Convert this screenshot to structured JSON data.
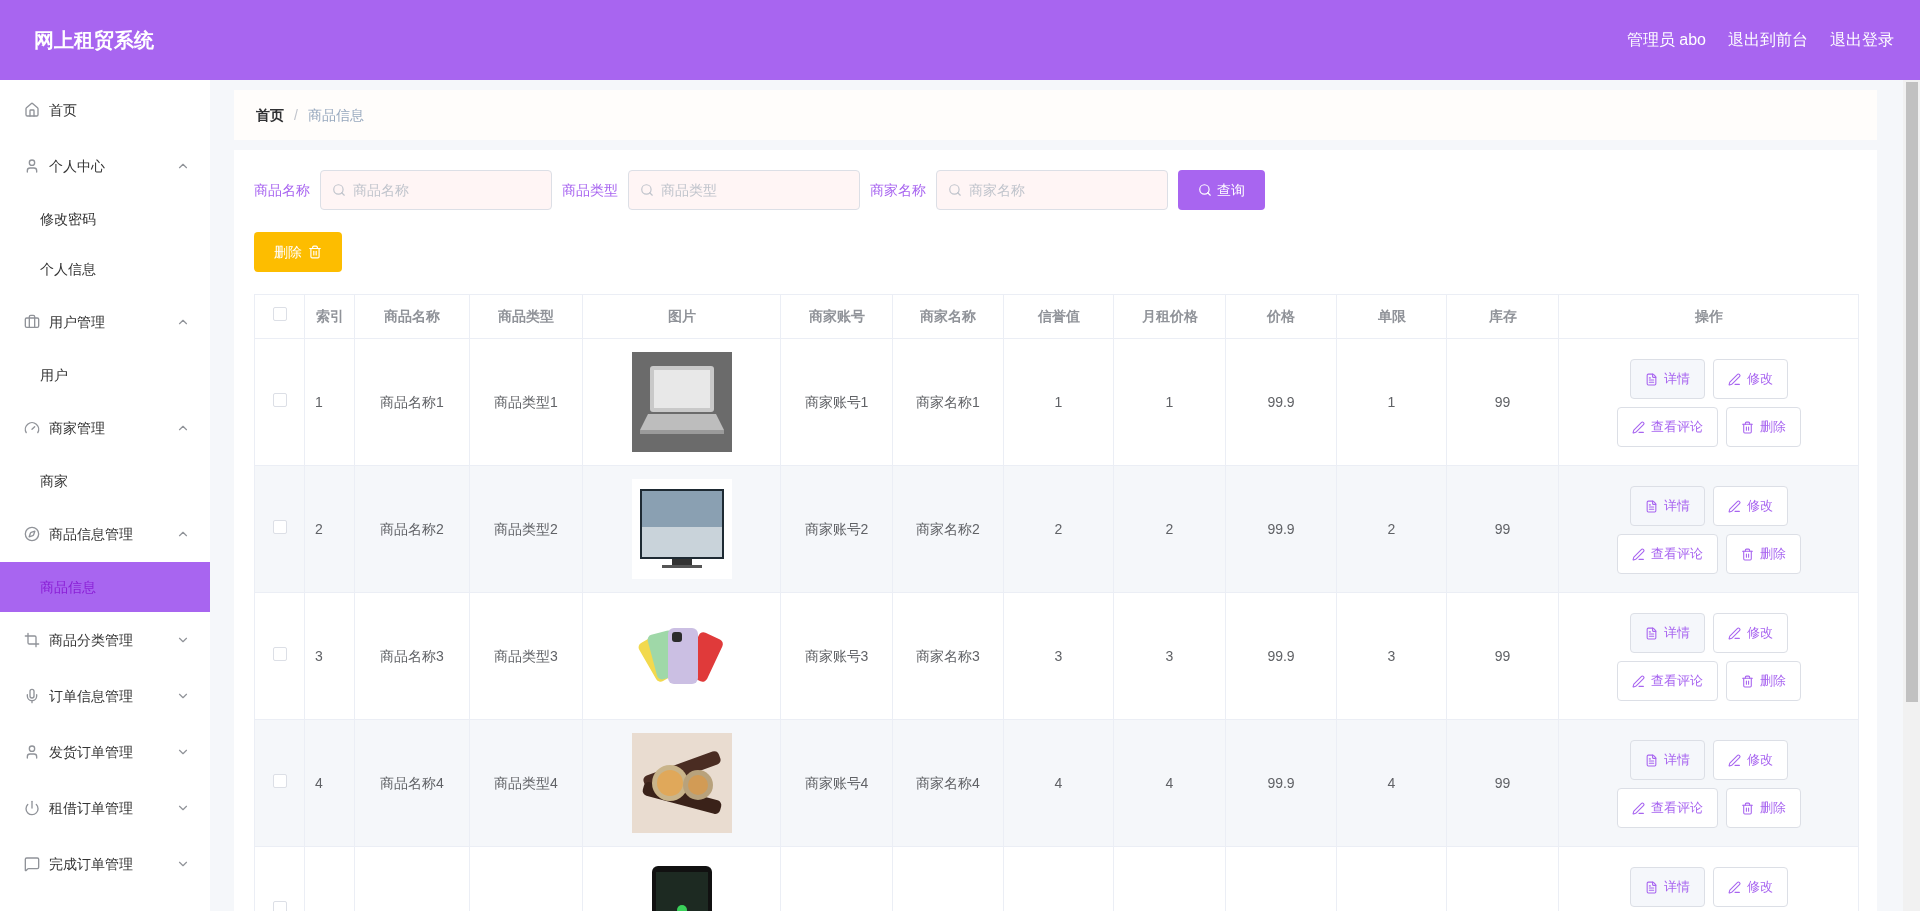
{
  "header": {
    "title": "网上租贸系统",
    "links": [
      "管理员 abo",
      "退出到前台",
      "退出登录"
    ]
  },
  "sidebar": {
    "items": [
      {
        "label": "首页",
        "kind": "link"
      },
      {
        "label": "个人中心",
        "kind": "group",
        "expanded": true,
        "children": [
          {
            "label": "修改密码",
            "selected": false
          },
          {
            "label": "个人信息",
            "selected": false
          }
        ]
      },
      {
        "label": "用户管理",
        "kind": "group",
        "expanded": true,
        "children": [
          {
            "label": "用户",
            "selected": false
          }
        ]
      },
      {
        "label": "商家管理",
        "kind": "group",
        "expanded": true,
        "children": [
          {
            "label": "商家",
            "selected": false
          }
        ]
      },
      {
        "label": "商品信息管理",
        "kind": "group",
        "expanded": true,
        "children": [
          {
            "label": "商品信息",
            "selected": true
          }
        ]
      },
      {
        "label": "商品分类管理",
        "kind": "group",
        "expanded": false
      },
      {
        "label": "订单信息管理",
        "kind": "group",
        "expanded": false
      },
      {
        "label": "发货订单管理",
        "kind": "group",
        "expanded": false
      },
      {
        "label": "租借订单管理",
        "kind": "group",
        "expanded": false
      },
      {
        "label": "完成订单管理",
        "kind": "group",
        "expanded": false
      }
    ]
  },
  "breadcrumb": {
    "items": [
      "首页",
      "商品信息"
    ],
    "separator": "/"
  },
  "search": {
    "fields": [
      {
        "label": "商品名称",
        "placeholder": "商品名称"
      },
      {
        "label": "商品类型",
        "placeholder": "商品类型"
      },
      {
        "label": "商家名称",
        "placeholder": "商家名称"
      }
    ],
    "button": "查询"
  },
  "delete_button": "删除",
  "table": {
    "all_checked": false,
    "columns": [
      "索引",
      "商品名称",
      "商品类型",
      "图片",
      "商家账号",
      "商家名称",
      "信誉值",
      "月租价格",
      "价格",
      "单限",
      "库存",
      "操作"
    ],
    "rows": [
      {
        "checked": false,
        "cells": [
          "1",
          "商品名称1",
          "商品类型1",
          "",
          "商家账号1",
          "商家名称1",
          "1",
          "1",
          "99.9",
          "1",
          "99"
        ],
        "image": {
          "kind": "picture"
        },
        "actions": [
          "详情",
          "修改",
          "查看评论",
          "删除"
        ]
      },
      {
        "checked": false,
        "cells": [
          "2",
          "商品名称2",
          "商品类型2",
          "",
          "商家账号2",
          "商家名称2",
          "2",
          "2",
          "99.9",
          "2",
          "99"
        ],
        "image": {
          "kind": "picture"
        },
        "actions": [
          "详情",
          "修改",
          "查看评论",
          "删除"
        ]
      },
      {
        "checked": false,
        "cells": [
          "3",
          "商品名称3",
          "商品类型3",
          "",
          "商家账号3",
          "商家名称3",
          "3",
          "3",
          "99.9",
          "3",
          "99"
        ],
        "image": {
          "kind": "picture"
        },
        "actions": [
          "详情",
          "修改",
          "查看评论",
          "删除"
        ]
      },
      {
        "checked": false,
        "cells": [
          "4",
          "商品名称4",
          "商品类型4",
          "",
          "商家账号4",
          "商家名称4",
          "4",
          "4",
          "99.9",
          "4",
          "99"
        ],
        "image": {
          "kind": "picture"
        },
        "actions": [
          "详情",
          "修改",
          "查看评论",
          "删除"
        ]
      },
      {
        "checked": false,
        "image": {
          "kind": "picture"
        },
        "actions": [
          "详情",
          "修改"
        ]
      }
    ]
  }
}
